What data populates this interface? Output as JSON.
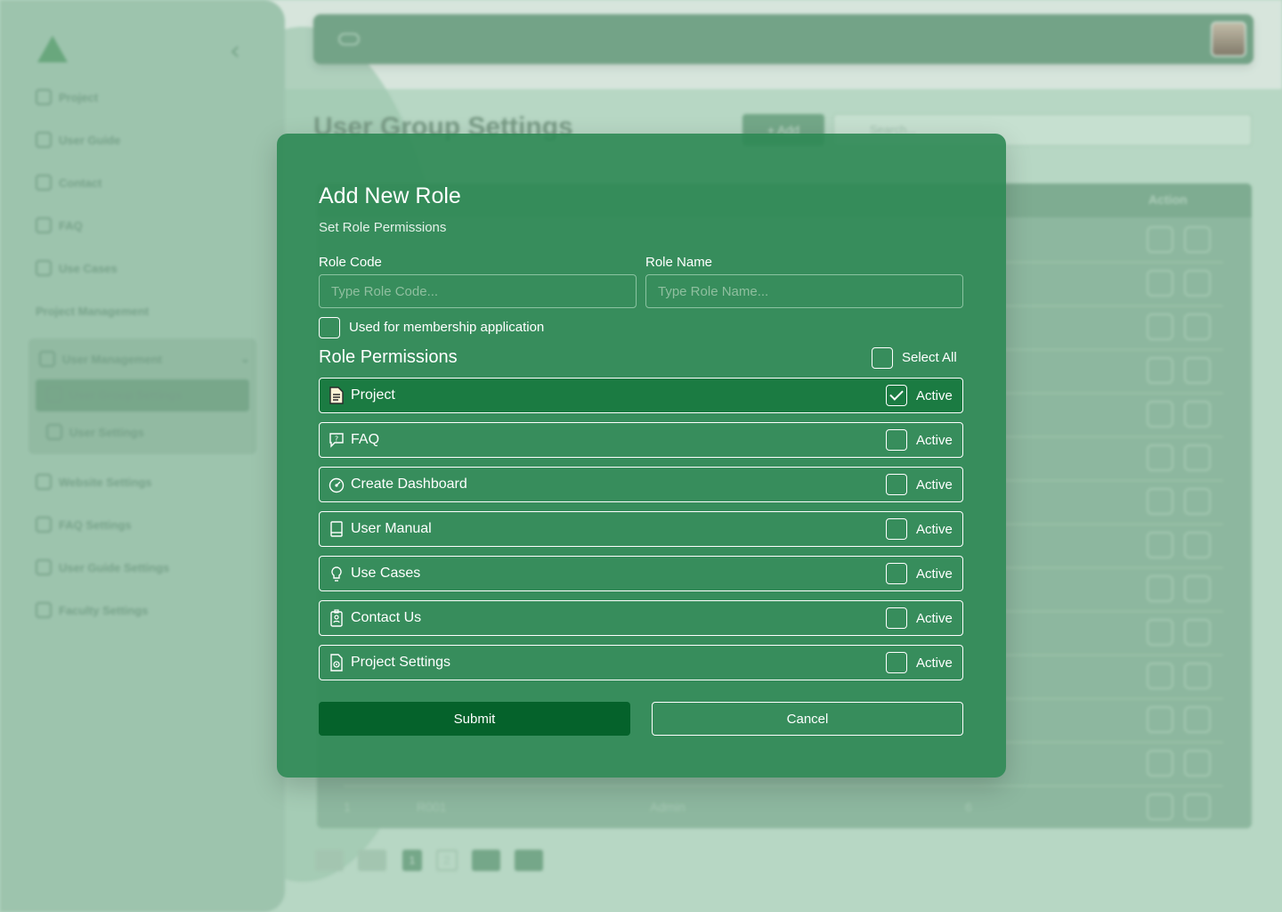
{
  "background": {
    "sidebar": {
      "items_top": [
        "Project",
        "User Guide",
        "Contact",
        "FAQ",
        "Use Cases"
      ],
      "section_heading": "Project Management",
      "user_management": "User Management",
      "sub_items": [
        "User Group Settings",
        "User Settings"
      ],
      "items_bottom": [
        "Website Settings",
        "FAQ Settings",
        "User Guide Settings",
        "Faculty Settings"
      ]
    },
    "page_title": "User Group Settings",
    "add_label": "+ Add",
    "search_placeholder": "Search...",
    "table": {
      "action_header": "Action",
      "last_row": [
        "1",
        "R001",
        "Admin",
        "6"
      ]
    },
    "pagination": [
      "1",
      "2"
    ]
  },
  "modal": {
    "title": "Add New Role",
    "subtitle": "Set Role Permissions",
    "role_code": {
      "label": "Role Code",
      "placeholder": "Type Role Code...",
      "value": ""
    },
    "role_name": {
      "label": "Role Name",
      "placeholder": "Type Role Name...",
      "value": ""
    },
    "membership": {
      "label": "Used for membership application",
      "checked": false
    },
    "permissions_title": "Role Permissions",
    "select_all": {
      "label": "Select All",
      "checked": false
    },
    "permissions": [
      {
        "label": "Project",
        "icon": "document-icon",
        "status": "Active",
        "checked": true
      },
      {
        "label": "FAQ",
        "icon": "chat-question-icon",
        "status": "Active",
        "checked": false
      },
      {
        "label": "Create Dashboard",
        "icon": "dashboard-gauge-icon",
        "status": "Active",
        "checked": false
      },
      {
        "label": "User Manual",
        "icon": "book-icon",
        "status": "Active",
        "checked": false
      },
      {
        "label": "Use Cases",
        "icon": "lightbulb-icon",
        "status": "Active",
        "checked": false
      },
      {
        "label": "Contact Us",
        "icon": "contact-badge-icon",
        "status": "Active",
        "checked": false
      },
      {
        "label": "Project Settings",
        "icon": "settings-document-icon",
        "status": "Active",
        "checked": false
      }
    ],
    "submit_label": "Submit",
    "cancel_label": "Cancel"
  },
  "colors": {
    "modal_bg": "#2e8854",
    "active_row": "#1b7b42",
    "submit_bg": "#05622b"
  }
}
